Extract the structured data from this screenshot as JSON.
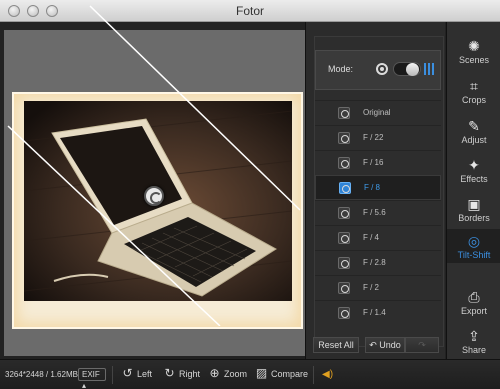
{
  "window": {
    "title": "Fotor"
  },
  "panel": {
    "mode_label": "Mode:",
    "apertures": [
      {
        "label": "Original",
        "selected": false
      },
      {
        "label": "F / 22",
        "selected": false
      },
      {
        "label": "F / 16",
        "selected": false
      },
      {
        "label": "F / 8",
        "selected": true
      },
      {
        "label": "F / 5.6",
        "selected": false
      },
      {
        "label": "F / 4",
        "selected": false
      },
      {
        "label": "F / 2.8",
        "selected": false
      },
      {
        "label": "F / 2",
        "selected": false
      },
      {
        "label": "F / 1.4",
        "selected": false
      }
    ],
    "reset_label": "Reset All",
    "undo_label": "Undo"
  },
  "sidebar": {
    "items": [
      {
        "label": "Scenes",
        "icon": "sun-icon"
      },
      {
        "label": "Crops",
        "icon": "crop-icon"
      },
      {
        "label": "Adjust",
        "icon": "pencil-icon"
      },
      {
        "label": "Effects",
        "icon": "sparkle-icon"
      },
      {
        "label": "Borders",
        "icon": "frame-icon"
      },
      {
        "label": "Tilt-Shift",
        "icon": "aperture-icon",
        "active": true
      },
      {
        "label": "Export",
        "icon": "export-icon"
      },
      {
        "label": "Share",
        "icon": "share-icon"
      }
    ]
  },
  "bottombar": {
    "image_info": "3264*2448 / 1.62MB",
    "exif_label": "EXIF",
    "left_label": "Left",
    "right_label": "Right",
    "zoom_label": "Zoom",
    "compare_label": "Compare"
  },
  "colors": {
    "accent": "#3b8fe0",
    "speaker": "#e0a020"
  }
}
